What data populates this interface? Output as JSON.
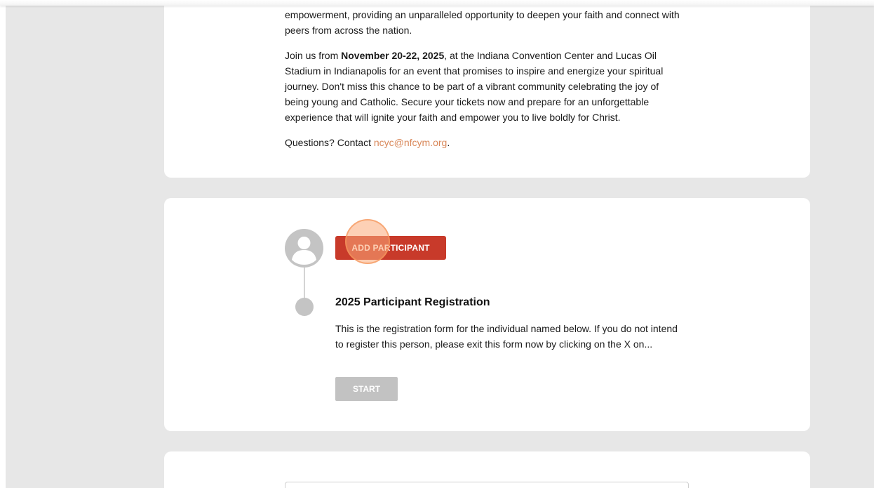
{
  "intro": {
    "para1_text": "empowerment, providing an unparalleled opportunity to deepen your faith and connect with peers from across the nation.",
    "para2_prefix": "Join us from ",
    "para2_dates": "November 20-22, 2025",
    "para2_rest": ", at the Indiana Convention Center and Lucas Oil Stadium in Indianapolis for an event that promises to inspire and energize your spiritual journey. Don't miss this chance to be part of a vibrant community celebrating the joy of being young and Catholic. Secure your tickets now and prepare for an unforgettable experience that will ignite your faith and empower you to live boldly for Christ.",
    "questions_prefix": "Questions? Contact ",
    "contact_email": "ncyc@nfcym.org",
    "questions_suffix": "."
  },
  "participant": {
    "add_button_label": "ADD PARTICIPANT",
    "registration_title": "2025 Participant Registration",
    "registration_desc": "This is the registration form for the individual named below. If you do not intend to register this person, please exit this form now by clicking on the X on...",
    "start_button_label": "START"
  },
  "colors": {
    "accent_red": "#c83a2a",
    "link_orange": "#d9885a",
    "page_gray": "#e7e7e7",
    "disabled_gray": "#c2c2c2"
  },
  "icons": {
    "avatar": "user-avatar-icon",
    "timeline": "timeline-dot-icon"
  }
}
